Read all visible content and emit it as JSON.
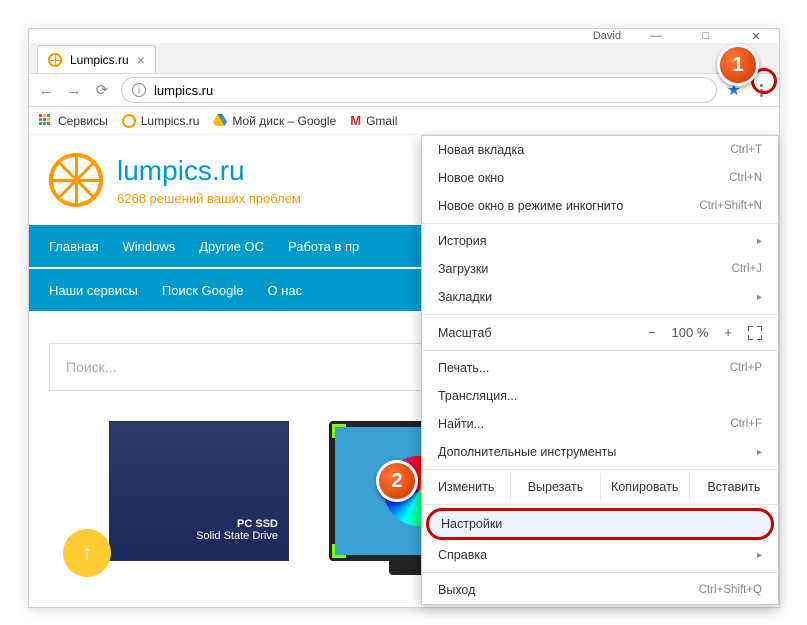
{
  "window": {
    "profile": "David",
    "tab_title": "Lumpics.ru"
  },
  "address": {
    "url": "lumpics.ru"
  },
  "bookmarks": {
    "apps": "Сервисы",
    "lumpics": "Lumpics.ru",
    "gdrive": "Мой диск – Google",
    "gmail": "Gmail"
  },
  "site": {
    "title": "lumpics.ru",
    "subtitle": "6268 решений ваших проблем",
    "nav1": [
      "Главная",
      "Windows",
      "Другие ОС",
      "Работа в пр"
    ],
    "nav2": [
      "Наши сервисы",
      "Поиск Google",
      "О нас"
    ],
    "search_placeholder": "Поиск...",
    "ssd_line1": "PC SSD",
    "ssd_line2": "Solid State Drive"
  },
  "menu": {
    "new_tab": "Новая вкладка",
    "new_tab_sc": "Ctrl+T",
    "new_window": "Новое окно",
    "new_window_sc": "Ctrl+N",
    "incognito": "Новое окно в режиме инкогнито",
    "incognito_sc": "Ctrl+Shift+N",
    "history": "История",
    "downloads": "Загрузки",
    "downloads_sc": "Ctrl+J",
    "bookmarks": "Закладки",
    "zoom_label": "Масштаб",
    "zoom_value": "100 %",
    "print": "Печать...",
    "print_sc": "Ctrl+P",
    "cast": "Трансляция...",
    "find": "Найти...",
    "find_sc": "Ctrl+F",
    "more_tools": "Дополнительные инструменты",
    "edit_label": "Изменить",
    "cut": "Вырезать",
    "copy": "Копировать",
    "paste": "Вставить",
    "settings": "Настройки",
    "help": "Справка",
    "exit": "Выход",
    "exit_sc": "Ctrl+Shift+Q"
  },
  "markers": {
    "one": "1",
    "two": "2"
  }
}
